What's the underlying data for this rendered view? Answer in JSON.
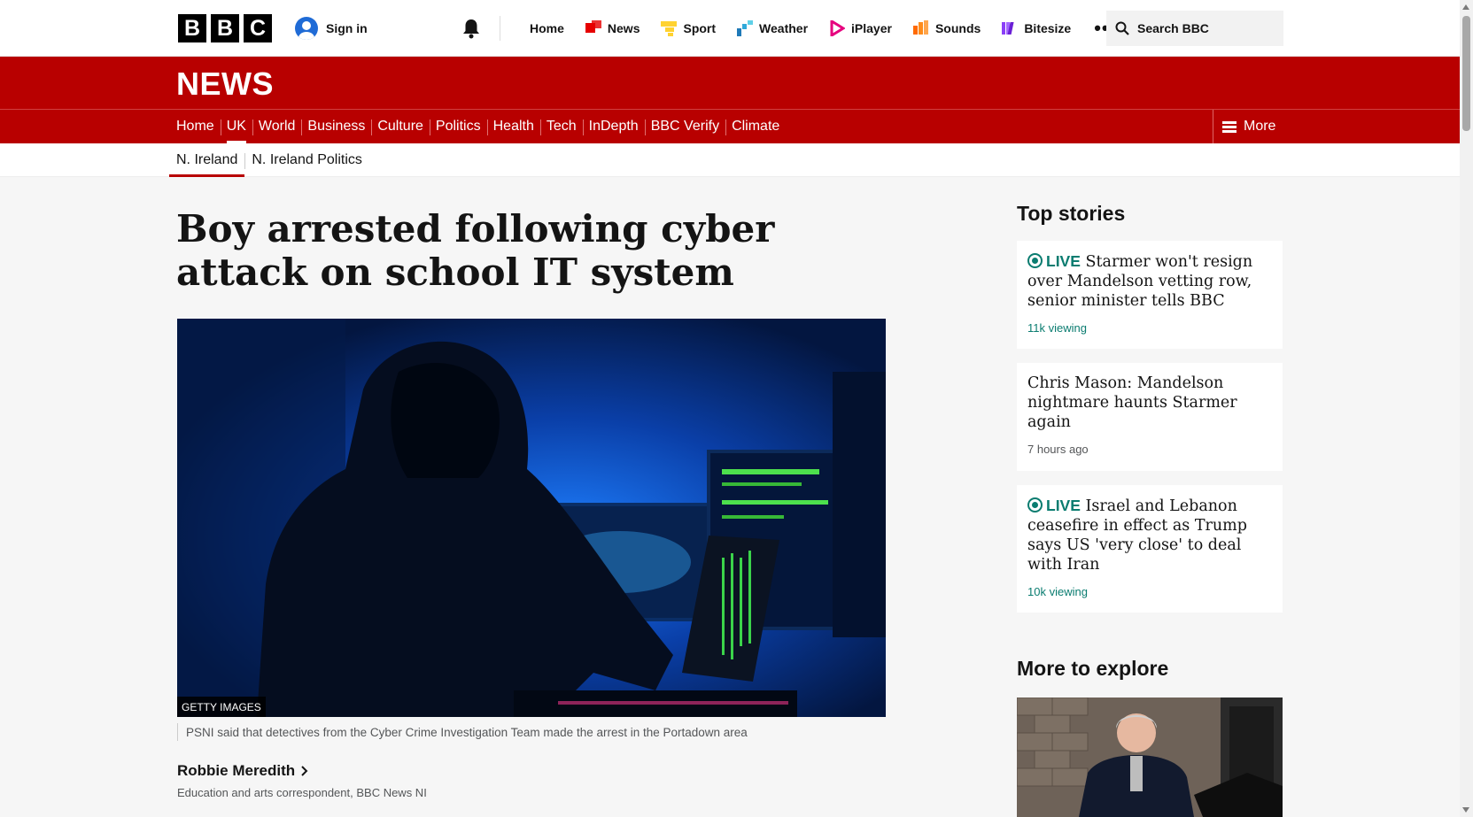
{
  "topbar": {
    "logo_letters": [
      "B",
      "B",
      "C"
    ],
    "signin_label": "Sign in",
    "nav": [
      {
        "label": "Home",
        "icon": ""
      },
      {
        "label": "News",
        "icon": "news-icon",
        "color": "#e60000"
      },
      {
        "label": "Sport",
        "icon": "sport-icon",
        "color": "#ffd230"
      },
      {
        "label": "Weather",
        "icon": "weather-icon",
        "color": "#1f7ab8"
      },
      {
        "label": "iPlayer",
        "icon": "iplayer-icon",
        "color": "#e6007e"
      },
      {
        "label": "Sounds",
        "icon": "sounds-icon",
        "color": "#ff6a00"
      },
      {
        "label": "Bitesize",
        "icon": "bitesize-icon",
        "color": "#8a3ff7"
      }
    ],
    "more_label": "•••",
    "search_placeholder": "Search BBC"
  },
  "masthead": {
    "title": "NEWS",
    "nav": [
      "Home",
      "UK",
      "World",
      "Business",
      "Culture",
      "Politics",
      "Health",
      "Tech",
      "InDepth",
      "BBC Verify",
      "Climate"
    ],
    "active": "UK",
    "more_label": "More",
    "accent": "#b80000"
  },
  "subnav": {
    "items": [
      "N. Ireland",
      "N. Ireland Politics"
    ],
    "active": "N. Ireland"
  },
  "article": {
    "headline": "Boy arrested following cyber attack on school IT system",
    "image_credit": "GETTY IMAGES",
    "caption": "PSNI said that detectives from the Cyber Crime Investigation Team made the arrest in the Portadown area",
    "author": "Robbie Meredith",
    "author_role": "Education and arts correspondent, BBC News NI"
  },
  "sidebar": {
    "top_stories_heading": "Top stories",
    "stories": [
      {
        "live": true,
        "live_label": "LIVE",
        "title": "Starmer won't resign over Mandelson vetting row, senior minister tells BBC",
        "meta": "11k viewing"
      },
      {
        "live": false,
        "live_label": "",
        "title": "Chris Mason: Mandelson nightmare haunts Starmer again",
        "meta": "7 hours ago"
      },
      {
        "live": true,
        "live_label": "LIVE",
        "title": "Israel and Lebanon ceasefire in effect as Trump says US 'very close' to deal with Iran",
        "meta": "10k viewing"
      }
    ],
    "explore_heading": "More to explore"
  }
}
